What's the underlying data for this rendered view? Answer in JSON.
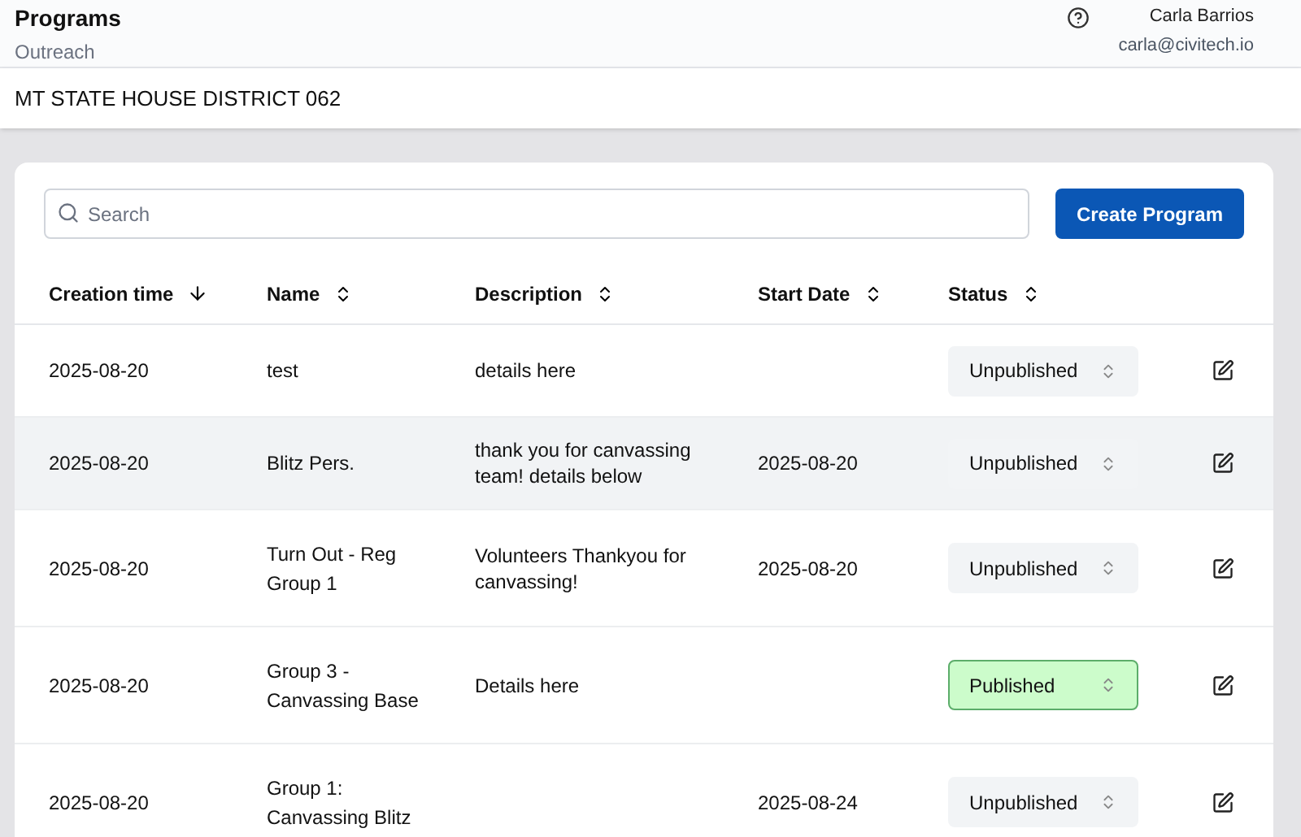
{
  "header": {
    "title": "Programs",
    "subtitle": "Outreach",
    "user_name": "Carla Barrios",
    "user_email": "carla@civitech.io"
  },
  "district": "MT STATE HOUSE DISTRICT 062",
  "search": {
    "placeholder": "Search"
  },
  "create_button": "Create Program",
  "table": {
    "columns": [
      {
        "label": "Creation time",
        "sorted": true
      },
      {
        "label": "Name",
        "sorted": false
      },
      {
        "label": "Description",
        "sorted": false
      },
      {
        "label": "Start Date",
        "sorted": false
      },
      {
        "label": "Status",
        "sorted": false
      }
    ],
    "rows": [
      {
        "created": "2025-08-20",
        "name": "test",
        "description": "details here",
        "start": "",
        "status": "Unpublished",
        "published": false,
        "hovered": false
      },
      {
        "created": "2025-08-20",
        "name": "Blitz Pers.",
        "description": "thank you for canvassing team! details below",
        "start": "2025-08-20",
        "status": "Unpublished",
        "published": false,
        "hovered": true
      },
      {
        "created": "2025-08-20",
        "name": "Turn Out - Reg Group 1",
        "description": "Volunteers Thankyou for canvassing!",
        "start": "2025-08-20",
        "status": "Unpublished",
        "published": false,
        "hovered": false
      },
      {
        "created": "2025-08-20",
        "name": "Group 3 - Canvassing Base",
        "description": "Details here",
        "start": "",
        "status": "Published",
        "published": true,
        "hovered": false
      },
      {
        "created": "2025-08-20",
        "name": "Group 1: Canvassing Blitz",
        "description": "",
        "start": "2025-08-24",
        "status": "Unpublished",
        "published": false,
        "hovered": false
      }
    ]
  }
}
